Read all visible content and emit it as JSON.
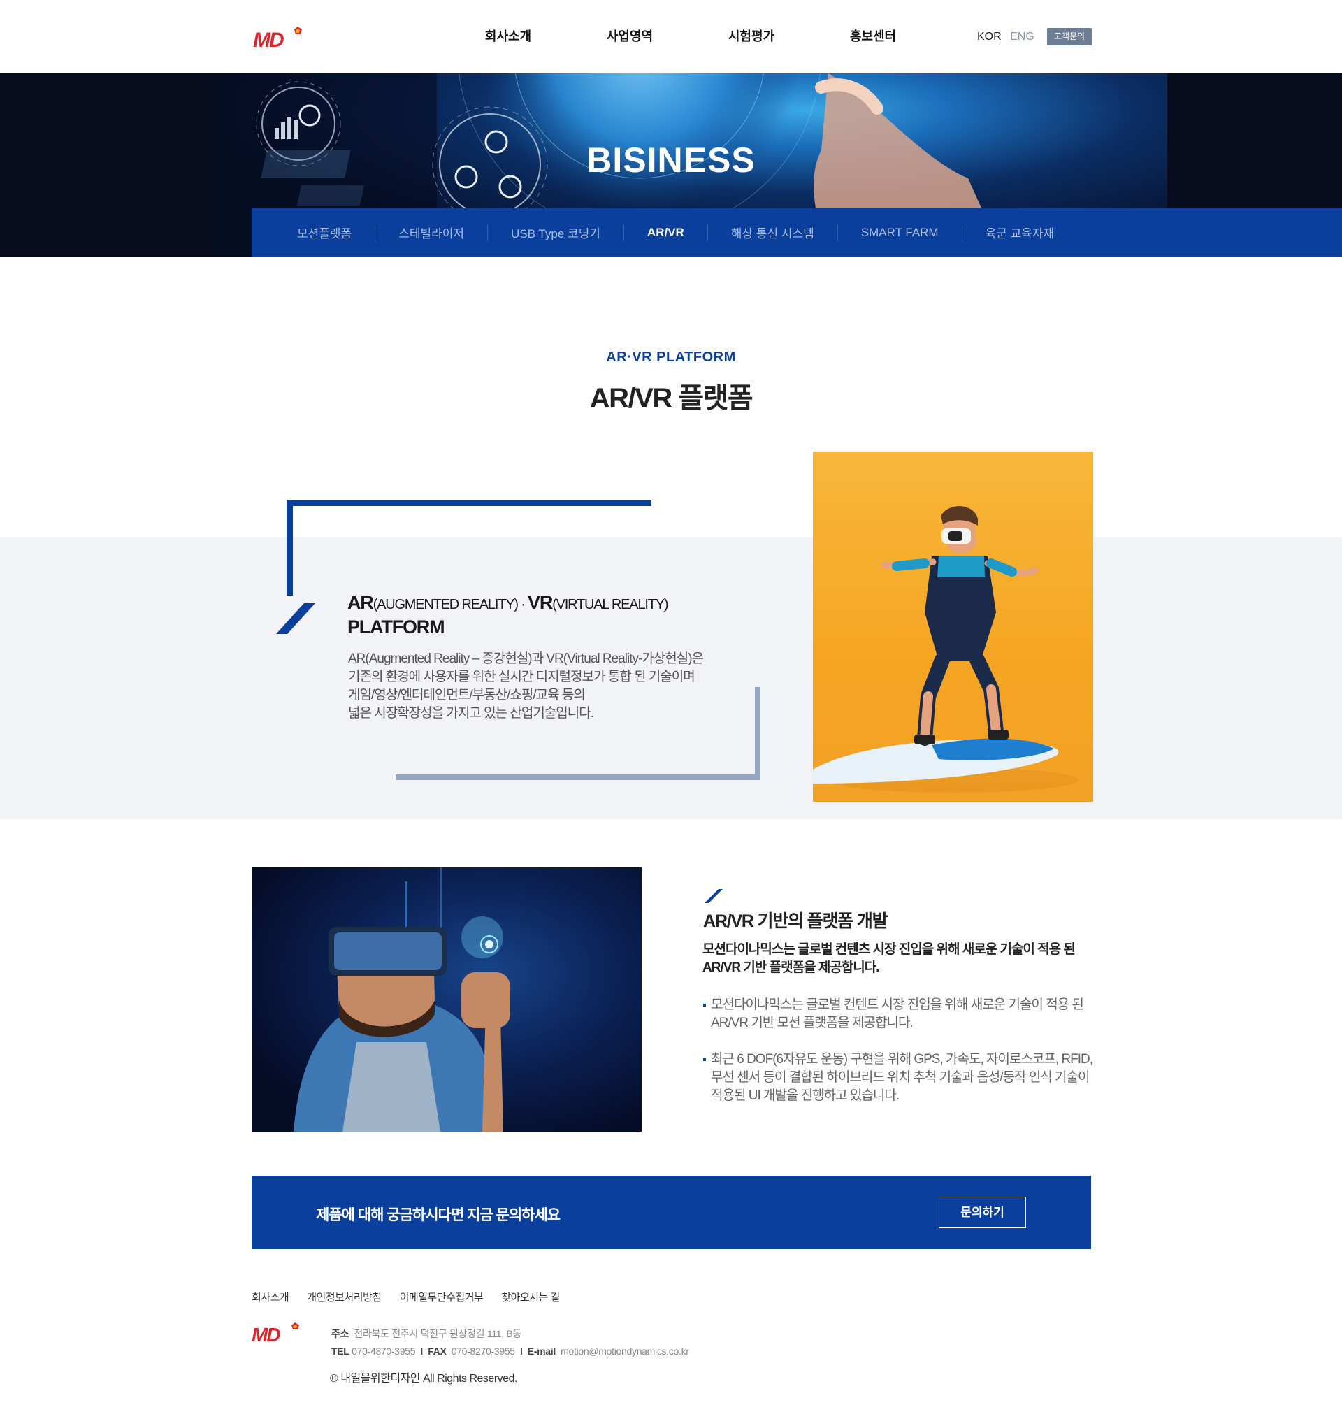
{
  "header": {
    "logo_text": "MD",
    "nav": [
      "회사소개",
      "사업영역",
      "시험평가",
      "홍보센터"
    ],
    "lang_kor": "KOR",
    "lang_eng": "ENG",
    "contact_label": "고객문의"
  },
  "banner": {
    "title": "BISINESS"
  },
  "subnav": {
    "items": [
      "모션플랫폼",
      "스테빌라이저",
      "USB Type 코딩기",
      "AR/VR",
      "해상 통신 시스템",
      "SMART FARM",
      "육군 교육자재"
    ],
    "active": "AR/VR"
  },
  "section": {
    "eyebrow": "AR·VR PLATFORM",
    "title": "AR/VR 플랫폼"
  },
  "platform": {
    "head_ar": "AR",
    "head_ar_sub": "(AUGMENTED REALITY)",
    "head_dot": " · ",
    "head_vr": "VR",
    "head_vr_sub": "(VIRTUAL REALITY)",
    "head_line2": "PLATFORM",
    "body_lines": [
      "AR(Augmented Reality – 증강현실)과 VR(Virtual Reality-가상현실)은",
      "기존의 환경에 사용자를 위한 실시간 디지털정보가 통합 된 기술이며",
      "게임/영상/엔터테인먼트/부동산/쇼핑/교육 등의",
      "넓은 시장확장성을 가지고 있는 산업기술입니다."
    ]
  },
  "development": {
    "title": "AR/VR 기반의 플랫폼 개발",
    "lead_lines": [
      "모션다이나믹스는 글로벌 컨텐츠 시장 진입을 위해 새로운 기술이 적용 된",
      "AR/VR 기반 플랫폼을 제공합니다."
    ],
    "bullets": [
      [
        "모션다이나믹스는 글로벌 컨텐트 시장 진입을 위해 새로운 기술이 적용 된",
        "AR/VR 기반 모션 플랫폼을 제공합니다."
      ],
      [
        "최근 6 DOF(6자유도 운동) 구현을 위해 GPS, 가속도, 자이로스코프, RFID,",
        "무선 센서 등이 결합된 하이브리드 위치 추척 기술과 음성/동작 인식 기술이",
        "적용된 UI 개발을 진행하고 있습니다."
      ]
    ]
  },
  "inquiry": {
    "text": "제품에 대해 궁금하시다면 지금 문의하세요",
    "button": "문의하기"
  },
  "footer": {
    "links": [
      "회사소개",
      "개인정보처리방침",
      "이메일무단수집거부",
      "찾아오시는 길"
    ],
    "address_label": "주소",
    "address": "전라북도 전주시 덕진구 원상정길 111, B동",
    "tel_label": "TEL",
    "tel": "070-4870-3955",
    "fax_label": "FAX",
    "fax": "070-8270-3955",
    "email_label": "E-mail",
    "email": "motion@motiondynamics.co.kr",
    "sep": "l",
    "copyright": "© 내일을위한디자인  All Rights Reserved."
  },
  "colors": {
    "brand_blue": "#0a3f9d",
    "logo_red": "#e0262b",
    "frame_grey": "#97a6c0",
    "band_grey": "#f2f3f6"
  },
  "icons": [
    "logo-mark",
    "slash-accent",
    "bullet-square"
  ]
}
